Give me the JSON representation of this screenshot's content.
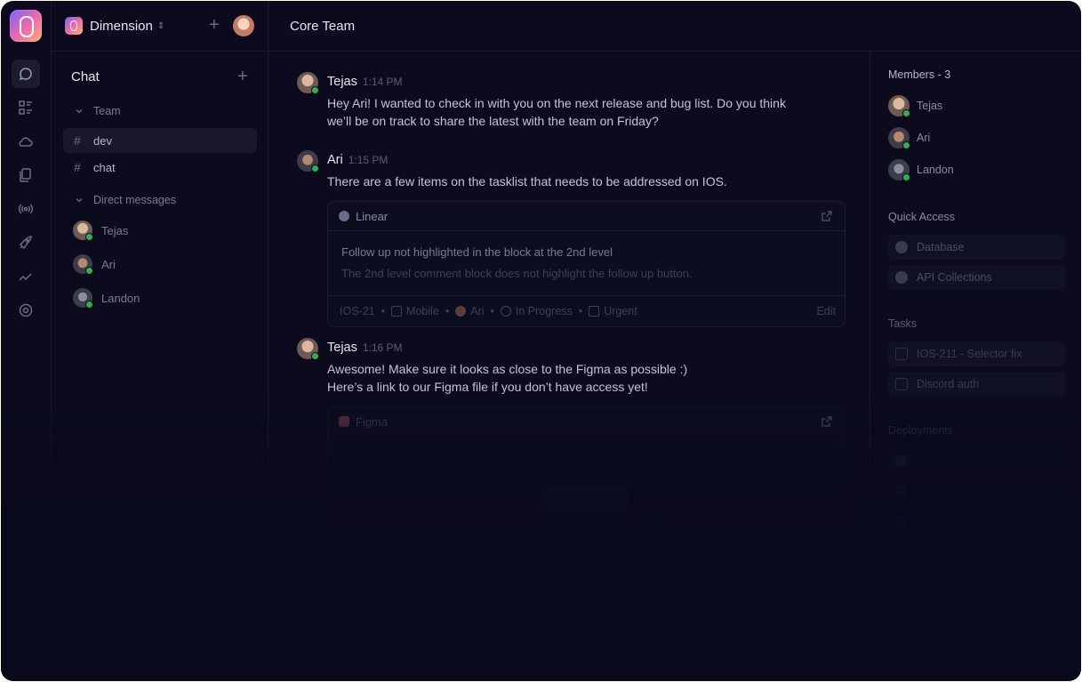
{
  "workspace": {
    "name": "Dimension"
  },
  "channel_title": "Core Team",
  "sidebar": {
    "title": "Chat",
    "team_section": "Team",
    "channels": [
      {
        "label": "dev"
      },
      {
        "label": "chat"
      }
    ],
    "dm_section": "Direct messages",
    "dms": [
      {
        "label": "Tejas"
      },
      {
        "label": "Ari"
      },
      {
        "label": "Landon"
      }
    ]
  },
  "messages": [
    {
      "author": "Tejas",
      "time": "1:14 PM",
      "lines": [
        "Hey Ari! I wanted to check in with you on the next release and bug list. Do you think",
        "we’ll be on track to share the latest with the team on Friday?"
      ]
    },
    {
      "author": "Ari",
      "time": "1:15 PM",
      "lines": [
        "There are a few items on the tasklist that needs to be addressed on IOS."
      ]
    },
    {
      "author": "Tejas",
      "time": "1:16 PM",
      "lines": [
        "Awesome! Make sure it looks as close to the Figma as possible :)",
        "Here’s a link to our Figma file if you don’t have access yet!"
      ]
    }
  ],
  "linear_card": {
    "source": "Linear",
    "title": "Follow up not highlighted in the block at the 2nd level",
    "subtitle": "The 2nd level comment block does not highlight the follow up button.",
    "id": "IOS-21",
    "platform": "Mobile",
    "assignee": "Ari",
    "status": "In Progress",
    "priority": "Urgent",
    "edit": "Edit"
  },
  "figma_card": {
    "source": "Figma"
  },
  "right_panel": {
    "members_heading": "Members - 3",
    "members": [
      {
        "name": "Tejas"
      },
      {
        "name": "Ari"
      },
      {
        "name": "Landon"
      }
    ],
    "quick_access_heading": "Quick Access",
    "quick_access": [
      {
        "label": "Database"
      },
      {
        "label": "API Collections"
      }
    ],
    "tasks_heading": "Tasks",
    "tasks": [
      {
        "label": "IOS-211 - Selector fix"
      },
      {
        "label": "Discord auth"
      }
    ],
    "deployments_heading": "Deployments"
  },
  "colors": {
    "background": "#0b0b1d",
    "online": "#2bb24c",
    "brand_gradient": [
      "#7b61ff",
      "#f06aa9",
      "#ffb36b"
    ]
  },
  "icons": [
    "chat-icon",
    "tasks-icon",
    "cloud-icon",
    "files-icon",
    "broadcast-icon",
    "rocket-icon",
    "activity-icon",
    "settings-icon"
  ]
}
